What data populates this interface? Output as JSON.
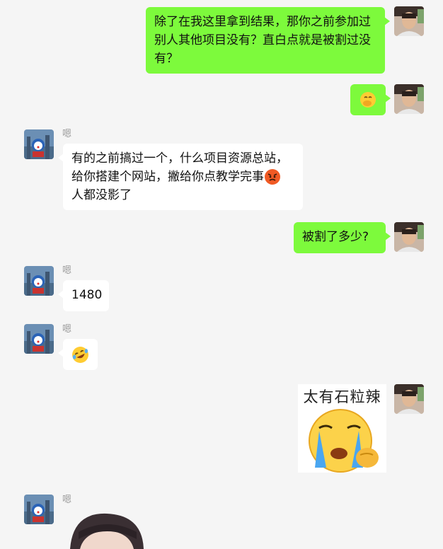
{
  "messages": [
    {
      "from": "self",
      "text": "除了在我这里拿到结果，那你之前参加过别人其他项目没有？直白点就是被割过没有？"
    },
    {
      "from": "self",
      "emoji": "face-with-hand-over-mouth"
    },
    {
      "from": "other",
      "sender": "嗯",
      "text": "有的之前搞过一个，什么项目资源总站，给你搭建个网站，撇给你点教学完事",
      "text_after": "人都没影了",
      "inline_emoji": "angry-face"
    },
    {
      "from": "self",
      "text": "被割了多少?"
    },
    {
      "from": "other",
      "sender": "嗯",
      "text": "1480"
    },
    {
      "from": "other",
      "sender": "嗯",
      "emoji": "rolling-laughing-face"
    },
    {
      "from": "self",
      "sticker_text": "太有石粒辣",
      "sticker": "crying-face-sticker"
    },
    {
      "from": "other",
      "sender": "嗯",
      "image": "photo-of-person"
    }
  ],
  "colors": {
    "self_bubble": "#7dfa3c",
    "other_bubble": "#ffffff",
    "background": "#f5f5f5"
  }
}
